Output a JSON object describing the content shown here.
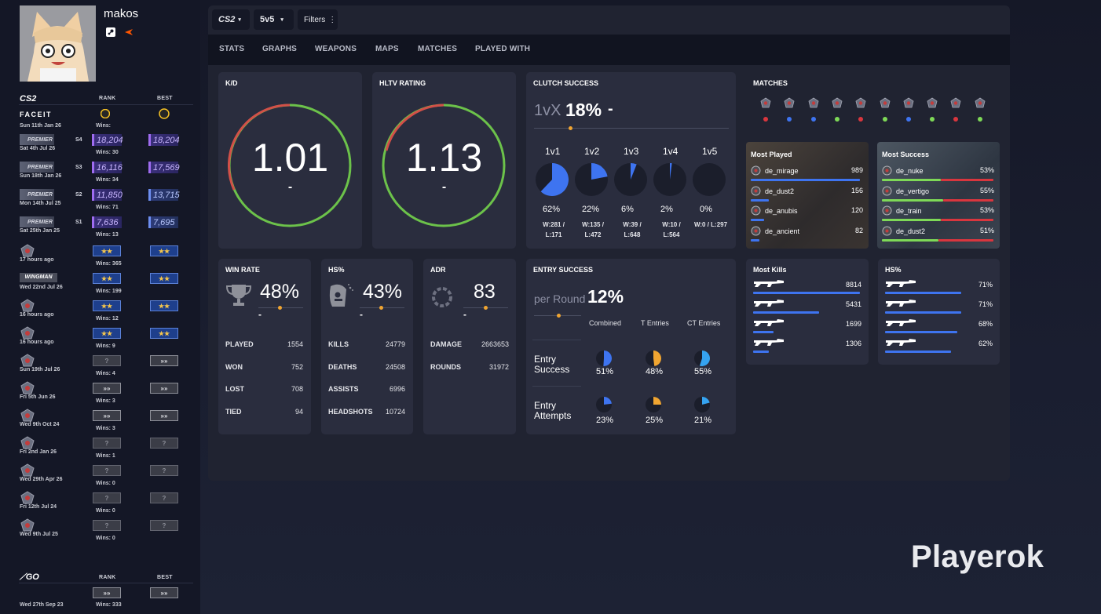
{
  "profile": {
    "name": "makos"
  },
  "cs2": {
    "logo": "CS2",
    "rank_header": "RANK",
    "best_header": "BEST",
    "faceit_label": "FACEIT",
    "rows": [
      {
        "date": "Sun 11th Jan 26",
        "wins": "Wins:"
      },
      {
        "date": "Sat 4th Jul 26",
        "season": "S4",
        "premier": "PREMIER",
        "wins": "Wins: 30",
        "rank": "18,204",
        "best": "18,204"
      },
      {
        "date": "Sun 18th Jan 26",
        "season": "S3",
        "premier": "PREMIER",
        "wins": "Wins: 34",
        "rank": "16,116",
        "best": "17,569"
      },
      {
        "date": "Mon 14th Jul 25",
        "season": "S2",
        "premier": "PREMIER",
        "wins": "Wins: 71",
        "rank": "11,850",
        "best": "13,715"
      },
      {
        "date": "Sat 25th Jan 25",
        "season": "S1",
        "premier": "PREMIER",
        "wins": "Wins: 13",
        "rank": "7,636",
        "best": "7,695"
      },
      {
        "date": "17 hours ago",
        "wins": "Wins: 365"
      },
      {
        "date": "Wed 22nd Jul 26",
        "wingman": "WINGMAN",
        "wins": "Wins: 199"
      },
      {
        "date": "16 hours ago",
        "wins": "Wins: 12"
      },
      {
        "date": "16 hours ago",
        "wins": "Wins: 9"
      },
      {
        "date": "Sun 19th Jul 26",
        "wins": "Wins: 4",
        "rank": "?"
      },
      {
        "date": "Fri 5th Jun 26",
        "wins": "Wins: 3"
      },
      {
        "date": "Wed 9th Oct 24",
        "wins": "Wins: 3"
      },
      {
        "date": "Fri 2nd Jan 26",
        "wins": "Wins: 1",
        "rank": "?",
        "best": "?"
      },
      {
        "date": "Wed 29th Apr 26",
        "wins": "Wins: 0",
        "rank": "?",
        "best": "?"
      },
      {
        "date": "Fri 12th Jul 24",
        "wins": "Wins: 0",
        "rank": "?",
        "best": "?"
      },
      {
        "date": "Wed 9th Jul 25",
        "wins": "Wins: 0",
        "rank": "?",
        "best": "?"
      }
    ]
  },
  "csgo": {
    "logo": "GO",
    "rank_header": "RANK",
    "best_header": "BEST",
    "date": "Wed 27th Sep 23",
    "wins": "Wins: 333"
  },
  "toolbar": {
    "game": "CS2",
    "mode": "5v5",
    "filters": "Filters"
  },
  "nav": [
    "STATS",
    "GRAPHS",
    "WEAPONS",
    "MAPS",
    "MATCHES",
    "PLAYED WITH"
  ],
  "kd": {
    "title": "K/D",
    "value": "1.01",
    "sub": "-"
  },
  "hltv": {
    "title": "HLTV RATING",
    "value": "1.13",
    "sub": "-"
  },
  "clutch": {
    "title": "CLUTCH SUCCESS",
    "prefix": "1vX",
    "value": "18%",
    "sub": "-",
    "items": [
      {
        "label": "1v1",
        "pct": "62%",
        "frac": 0.62,
        "wl1": "W:281 /",
        "wl2": "L:171"
      },
      {
        "label": "1v2",
        "pct": "22%",
        "frac": 0.22,
        "wl1": "W:135 /",
        "wl2": "L:472"
      },
      {
        "label": "1v3",
        "pct": "6%",
        "frac": 0.06,
        "wl1": "W:39 /",
        "wl2": "L:648"
      },
      {
        "label": "1v4",
        "pct": "2%",
        "frac": 0.02,
        "wl1": "W:10 /",
        "wl2": "L:564"
      },
      {
        "label": "1v5",
        "pct": "0%",
        "frac": 0.0,
        "wl1": "W:0 / L:297",
        "wl2": ""
      }
    ]
  },
  "matches": {
    "title": "MATCHES",
    "results": [
      "loss",
      "win",
      "loss",
      "win",
      "loss",
      "win",
      "loss",
      "win",
      "loss",
      "win"
    ],
    "dot_colors": [
      "#d9363e",
      "#3e74f0",
      "#3e74f0",
      "#7ed957",
      "#d9363e",
      "#7ed957",
      "#3e74f0",
      "#7ed957",
      "#d9363e",
      "#7ed957"
    ]
  },
  "most_played": {
    "title": "Most Played",
    "rows": [
      {
        "map": "de_mirage",
        "value": "989",
        "frac": 0.98
      },
      {
        "map": "de_dust2",
        "value": "156",
        "frac": 0.16
      },
      {
        "map": "de_anubis",
        "value": "120",
        "frac": 0.12
      },
      {
        "map": "de_ancient",
        "value": "82",
        "frac": 0.08
      }
    ]
  },
  "most_success": {
    "title": "Most Success",
    "rows": [
      {
        "map": "de_nuke",
        "value": "53%",
        "frac": 0.53
      },
      {
        "map": "de_vertigo",
        "value": "55%",
        "frac": 0.55
      },
      {
        "map": "de_train",
        "value": "53%",
        "frac": 0.53
      },
      {
        "map": "de_dust2",
        "value": "51%",
        "frac": 0.51
      }
    ]
  },
  "winrate": {
    "title": "WIN RATE",
    "value": "48%",
    "sub": "-",
    "rows": [
      [
        "PLAYED",
        "1554"
      ],
      [
        "WON",
        "752"
      ],
      [
        "LOST",
        "708"
      ],
      [
        "TIED",
        "94"
      ]
    ]
  },
  "hs": {
    "title": "HS%",
    "value": "43%",
    "sub": "-",
    "rows": [
      [
        "KILLS",
        "24779"
      ],
      [
        "DEATHS",
        "24508"
      ],
      [
        "ASSISTS",
        "6996"
      ],
      [
        "HEADSHOTS",
        "10724"
      ]
    ]
  },
  "adr": {
    "title": "ADR",
    "value": "83",
    "sub": "-",
    "rows": [
      [
        "DAMAGE",
        "2663653"
      ],
      [
        "ROUNDS",
        "31972"
      ]
    ]
  },
  "entry": {
    "title": "ENTRY SUCCESS",
    "prefix": "per Round",
    "value": "12%",
    "cols": [
      "Combined",
      "T Entries",
      "CT Entries"
    ],
    "row1_label1": "Entry",
    "row1_label2": "Success",
    "row2_label1": "Entry",
    "row2_label2": "Attempts",
    "success": [
      {
        "pct": "51%",
        "frac": 0.51
      },
      {
        "pct": "48%",
        "frac": 0.48
      },
      {
        "pct": "55%",
        "frac": 0.55
      }
    ],
    "attempts": [
      {
        "pct": "23%",
        "frac": 0.23
      },
      {
        "pct": "25%",
        "frac": 0.25
      },
      {
        "pct": "21%",
        "frac": 0.21
      }
    ],
    "colors": [
      "#3e74f0",
      "#f0a531",
      "#35a3f0"
    ]
  },
  "most_kills": {
    "title": "Most Kills",
    "rows": [
      {
        "value": "8814",
        "frac": 1.0
      },
      {
        "value": "5431",
        "frac": 0.62
      },
      {
        "value": "1699",
        "frac": 0.19
      },
      {
        "value": "1306",
        "frac": 0.15
      }
    ]
  },
  "hs_weapons": {
    "title": "HS%",
    "rows": [
      {
        "value": "71%",
        "frac": 0.71
      },
      {
        "value": "71%",
        "frac": 0.71
      },
      {
        "value": "68%",
        "frac": 0.68
      },
      {
        "value": "62%",
        "frac": 0.62
      }
    ]
  },
  "watermark": "Playerok"
}
